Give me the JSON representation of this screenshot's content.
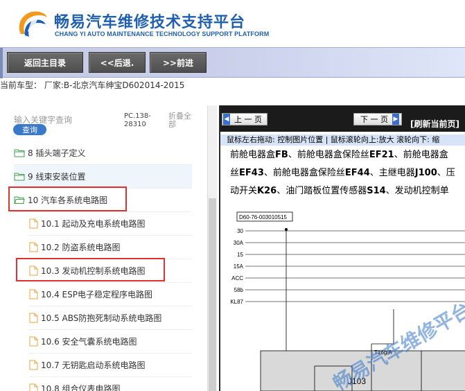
{
  "header": {
    "title_cn": "畅易汽车维修技术支持平台",
    "title_en": "CHANG YI AUTO MAINTENANCE TECHNOLOGY SUPPORT PLATFORM"
  },
  "nav": {
    "home": "返回主目录",
    "back": "<<后退.",
    "forward": ">>前进"
  },
  "model_line": "当前车型：  厂家:B-北京汽车绅宝D602014-2015",
  "left": {
    "search_placeholder": "输入关键字查询",
    "search_button": "查询",
    "pc_code": "PC.138-28310",
    "collapse_all": "折叠全部",
    "tree": [
      {
        "label": "8 插头端子定义",
        "type": "folder"
      },
      {
        "label": "9 线束安装位置",
        "type": "folder"
      },
      {
        "label": "10 汽车各系统电路图",
        "type": "folder-open"
      },
      {
        "label": "10.1 起动及充电系统电路图",
        "type": "file"
      },
      {
        "label": "10.2 防盗系统电路图",
        "type": "file"
      },
      {
        "label": "10.3 发动机控制系统电路图",
        "type": "file"
      },
      {
        "label": "10.4 ESP电子稳定程序电路图",
        "type": "file"
      },
      {
        "label": "10.5 ABS防抱死制动系统电路图",
        "type": "file"
      },
      {
        "label": "10.6 安全气囊系统电路图",
        "type": "file"
      },
      {
        "label": "10.7 无钥匙启动系统电路图",
        "type": "file"
      },
      {
        "label": "10.8 组合仪表电路图",
        "type": "file"
      }
    ]
  },
  "right": {
    "prev_page": "上 一 页",
    "next_page": "下 一 页",
    "refresh": "[刷新当前页]",
    "hint": "鼠标左右拖动: 控制图片位置 | 鼠标滚轮向上:放大  滚轮向下: 缩",
    "line1": {
      "t1": "前舱电器盒",
      "b1": "FB",
      "t2": "、前舱电器盒保险丝",
      "b2": "EF21",
      "t3": "、前舱电器盒"
    },
    "line2": {
      "t1": "丝",
      "b1": "EF43",
      "t2": "、前舱电器盒保险丝",
      "b2": "EF44",
      "t3": "、主继电器",
      "b3": "J100",
      "t4": "、压"
    },
    "line3": {
      "t1": "动开关",
      "b1": "K26",
      "t2": "、油门踏板位置传感器",
      "b2": "S14",
      "t3": "、发动机控制单"
    },
    "diagram": {
      "code": "D60-76-003010515",
      "rails": [
        "30",
        "30A",
        "15",
        "15A",
        "ACC",
        "58b",
        "KL87"
      ],
      "connector_label": "T16g/A",
      "module_label": "J103",
      "watermark": "畅易汽车维修平台"
    }
  },
  "colors": {
    "brand_blue": "#1f5fb0",
    "highlight_red": "#e03030",
    "search_blue": "#3a78c9"
  }
}
